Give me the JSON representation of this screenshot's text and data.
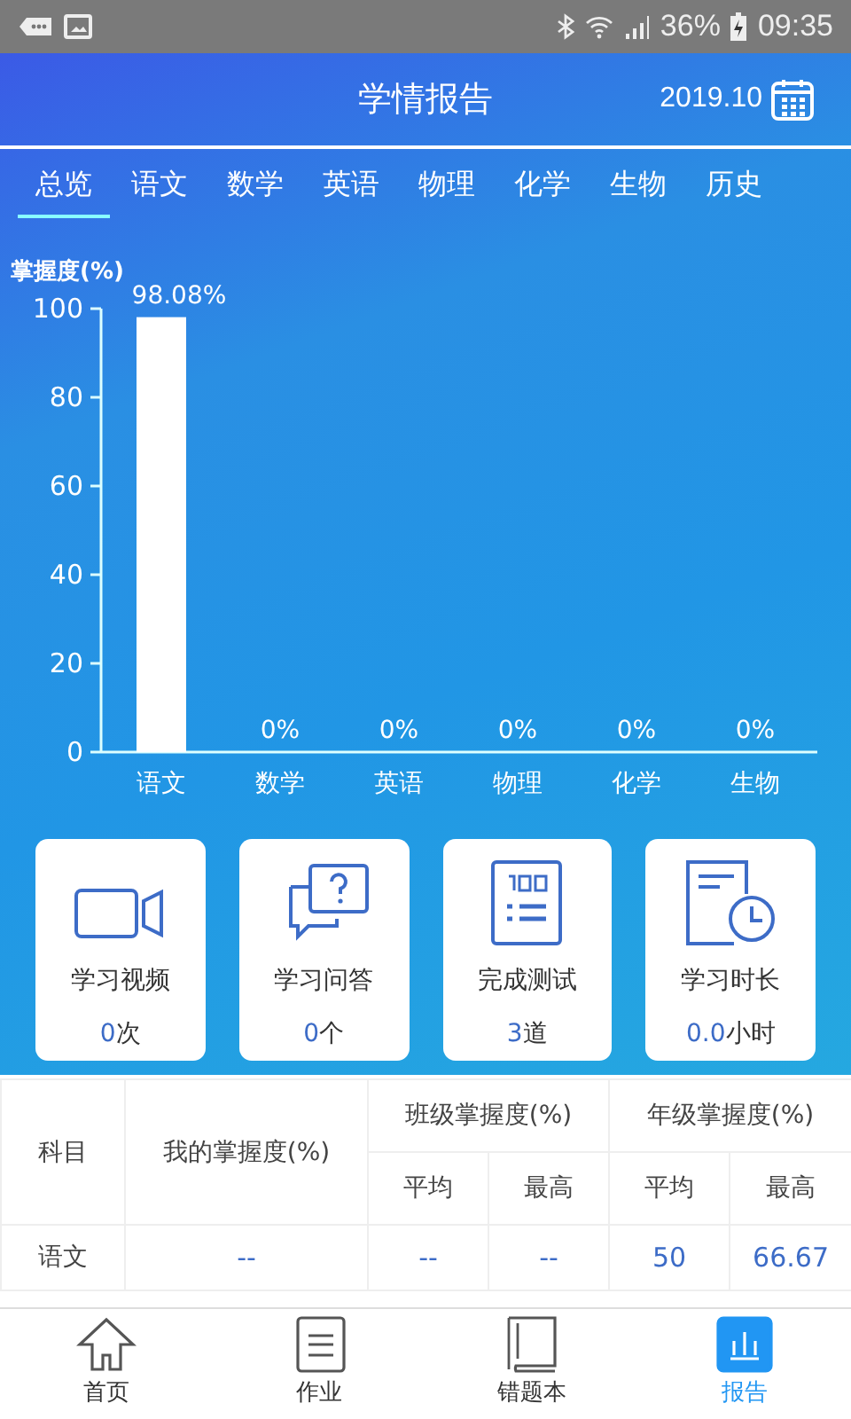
{
  "status_bar": {
    "battery": "36%",
    "time": "09:35"
  },
  "header": {
    "title": "学情报告",
    "date": "2019.10"
  },
  "tabs": [
    {
      "label": "总览",
      "selected": true
    },
    {
      "label": "语文",
      "selected": false
    },
    {
      "label": "数学",
      "selected": false
    },
    {
      "label": "英语",
      "selected": false
    },
    {
      "label": "物理",
      "selected": false
    },
    {
      "label": "化学",
      "selected": false
    },
    {
      "label": "生物",
      "selected": false
    },
    {
      "label": "历史",
      "selected": false
    }
  ],
  "chart": {
    "chart_data": {
      "type": "bar",
      "ylabel": "掌握度(%)",
      "categories": [
        "语文",
        "数学",
        "英语",
        "物理",
        "化学",
        "生物"
      ],
      "values": [
        98.08,
        0,
        0,
        0,
        0,
        0
      ],
      "ylim": [
        0,
        100
      ],
      "yticks": [
        0,
        20,
        40,
        60,
        80,
        100
      ],
      "data_labels": true,
      "value_labels": [
        "98.08%",
        "0%",
        "0%",
        "0%",
        "0%",
        "0%"
      ]
    }
  },
  "stats": [
    {
      "label": "学习视频",
      "value": "0",
      "unit": "次"
    },
    {
      "label": "学习问答",
      "value": "0",
      "unit": "个"
    },
    {
      "label": "完成测试",
      "value": "3",
      "unit": "道"
    },
    {
      "label": "学习时长",
      "value": "0.0",
      "unit": "小时"
    }
  ],
  "table": {
    "subject_header": "科目",
    "mine_header": "我的掌握度(%)",
    "class_header": "班级掌握度(%)",
    "grade_header": "年级掌握度(%)",
    "sub_headers": [
      "平均",
      "最高",
      "平均",
      "最高"
    ],
    "rows": [
      {
        "subject": "语文",
        "cells": [
          "--",
          "--",
          "--",
          "50",
          "66.67"
        ]
      }
    ]
  },
  "nav": [
    {
      "label": "首页",
      "selected": false
    },
    {
      "label": "作业",
      "selected": false
    },
    {
      "label": "错题本",
      "selected": false
    },
    {
      "label": "报告",
      "selected": true
    }
  ]
}
